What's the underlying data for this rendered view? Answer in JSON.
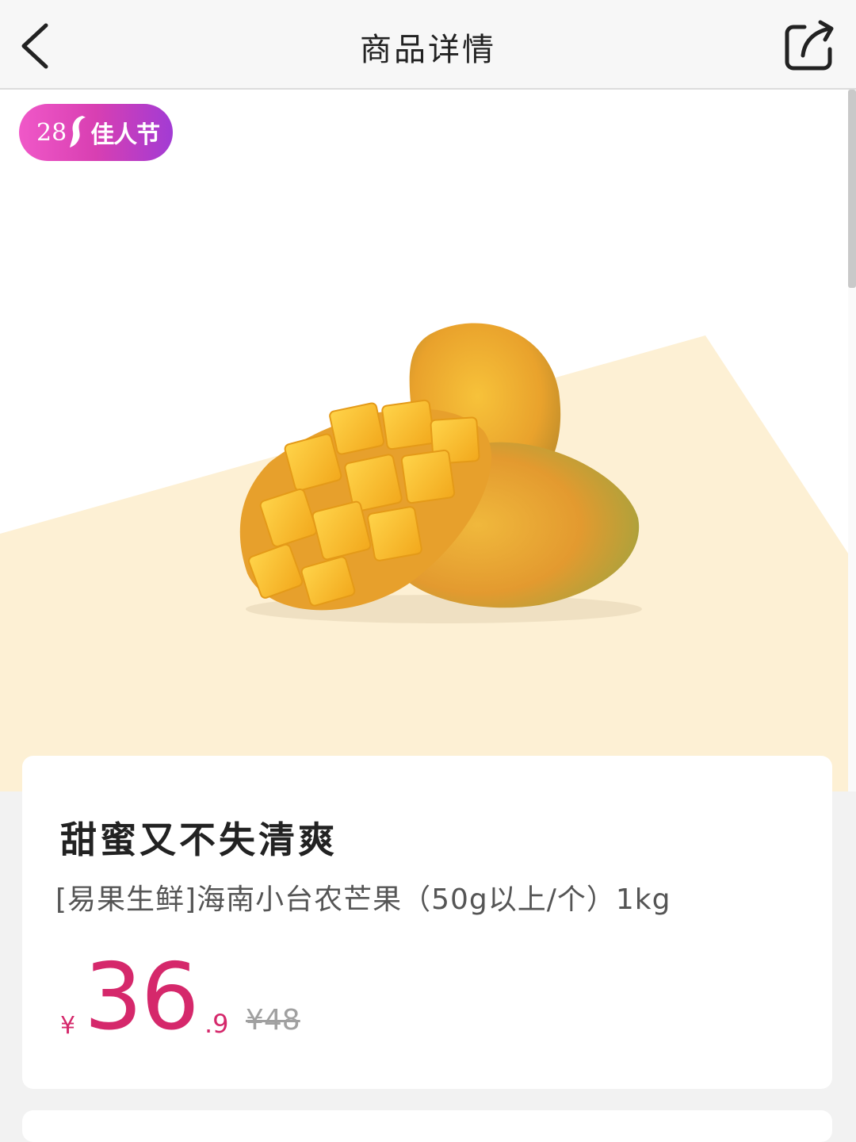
{
  "header": {
    "title": "商品详情",
    "back_icon": "chevron-left-icon",
    "share_icon": "share-icon"
  },
  "promo": {
    "number": "28",
    "label": "佳人节",
    "icon": "woman-silhouette-icon",
    "colors": [
      "#f058c8",
      "#a23bd4"
    ]
  },
  "product": {
    "tagline": "甜蜜又不失清爽",
    "name": "[易果生鲜]海南小台农芒果（50g以上/个）1kg",
    "price": {
      "currency": "¥",
      "integer": "36",
      "decimal": ".9",
      "original": "¥48"
    },
    "image": "mango-product-image"
  },
  "colors": {
    "price": "#d5286b",
    "hero_accent": "#fdf0d4",
    "background": "#f2f2f2"
  }
}
